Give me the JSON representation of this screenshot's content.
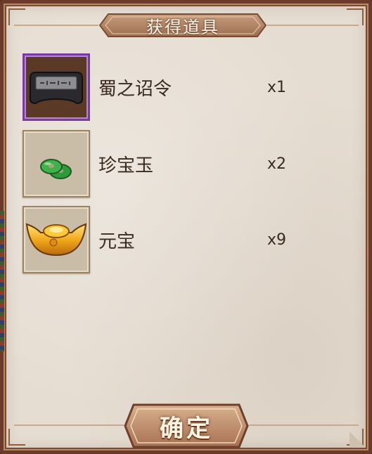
{
  "dialog": {
    "title": "获得道具",
    "confirm_label": "确定"
  },
  "items": [
    {
      "name": "蜀之诏令",
      "count": "x1",
      "icon": "decree-tablet-icon",
      "frame": "purple"
    },
    {
      "name": "珍宝玉",
      "count": "x2",
      "icon": "jade-coin-icon",
      "frame": "plain"
    },
    {
      "name": "元宝",
      "count": "x9",
      "icon": "gold-ingot-icon",
      "frame": "plain"
    }
  ],
  "colors": {
    "panel": "#e6ddd2",
    "border": "#6b3a2b",
    "title_banner": "#b08566",
    "rare_frame": "#7b3aa0",
    "text": "#3a2a20"
  }
}
